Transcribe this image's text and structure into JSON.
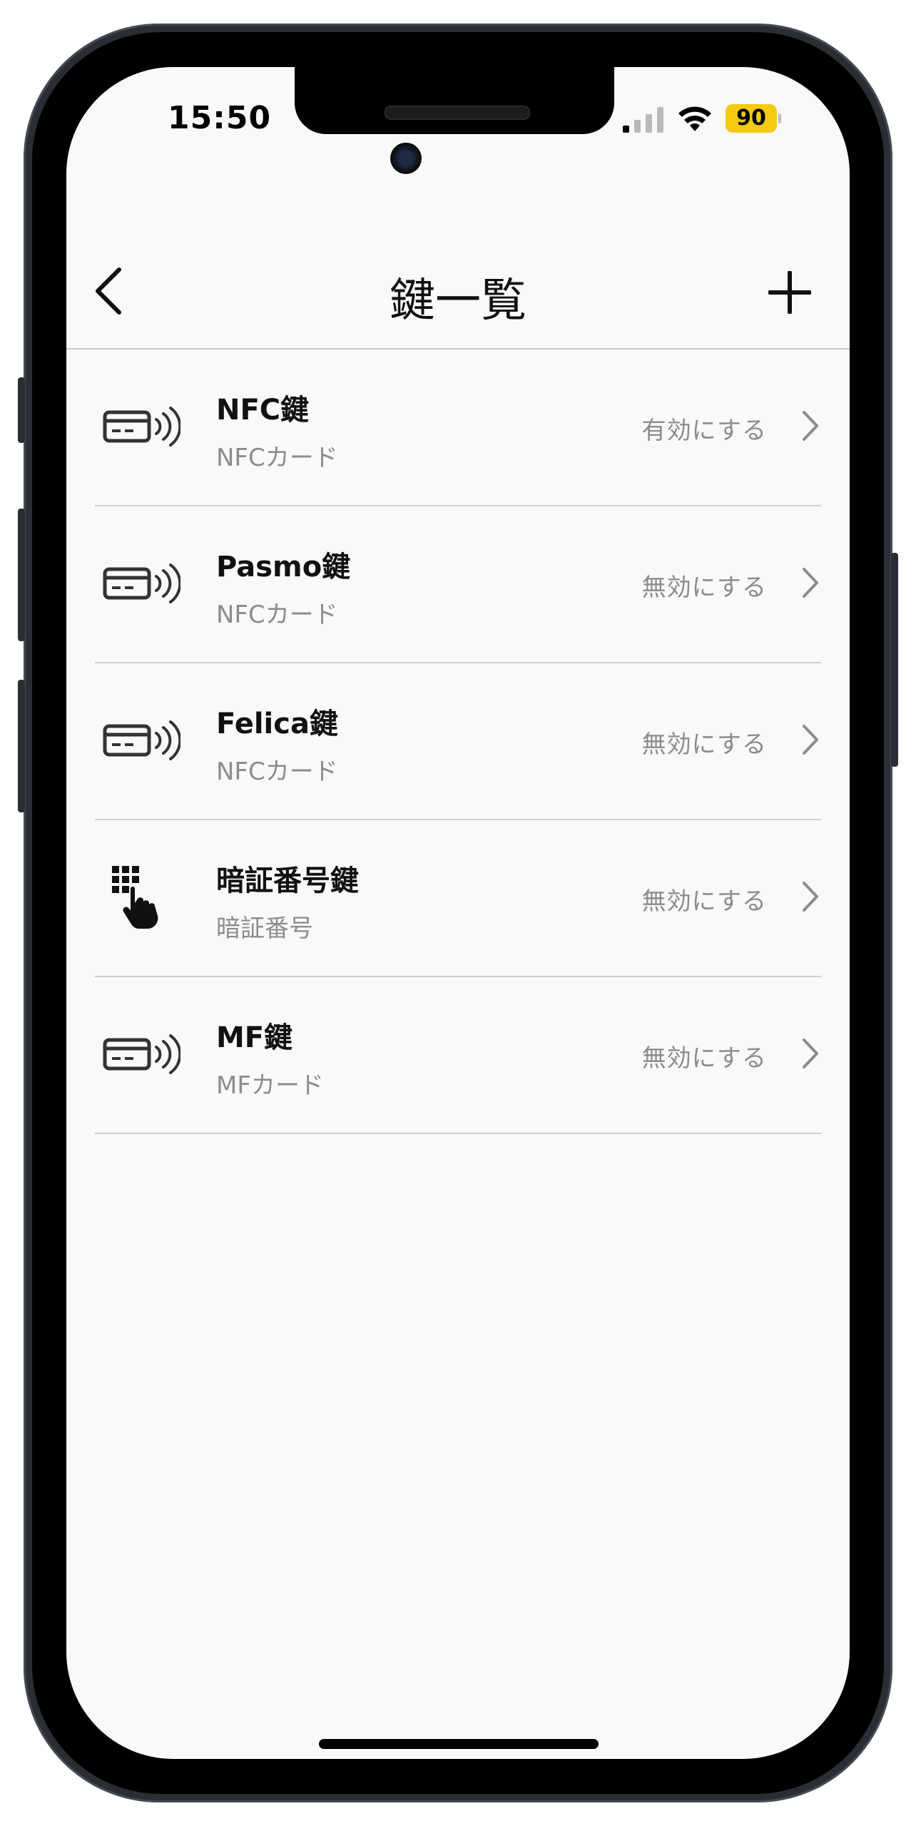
{
  "status_bar": {
    "time": "15:50",
    "battery": "90",
    "battery_color": "#f6c912"
  },
  "nav": {
    "title": "鍵一覧",
    "back_icon": "chevron-left-icon",
    "add_icon": "plus-icon"
  },
  "keys": [
    {
      "name": "NFC鍵",
      "type": "NFCカード",
      "action": "有効にする",
      "icon": "nfc-card-icon"
    },
    {
      "name": "Pasmo鍵",
      "type": "NFCカード",
      "action": "無効にする",
      "icon": "nfc-card-icon"
    },
    {
      "name": "Felica鍵",
      "type": "NFCカード",
      "action": "無効にする",
      "icon": "nfc-card-icon"
    },
    {
      "name": "暗証番号鍵",
      "type": "暗証番号",
      "action": "無効にする",
      "icon": "keypad-icon"
    },
    {
      "name": "MF鍵",
      "type": "MFカード",
      "action": "無効にする",
      "icon": "nfc-card-icon"
    }
  ]
}
